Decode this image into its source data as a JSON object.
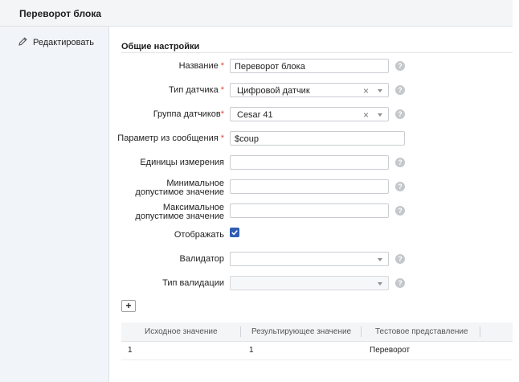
{
  "window": {
    "title": "Переворот блока"
  },
  "sidebar": {
    "edit_label": "Редактировать"
  },
  "section": {
    "title": "Общие настройки"
  },
  "form": {
    "name": {
      "label": "Название",
      "value": "Переворот блока"
    },
    "sensor_type": {
      "label": "Тип датчика",
      "value": "Цифровой датчик",
      "clear": "×"
    },
    "sensor_group": {
      "label": "Группа датчиков",
      "value": "Cesar 41",
      "clear": "×"
    },
    "message_param": {
      "label": "Параметр из сообщения",
      "value": "$coup"
    },
    "units": {
      "label": "Единицы измерения",
      "value": ""
    },
    "min_value": {
      "label_line1": "Минимальное",
      "label_line2": "допустимое значение",
      "value": ""
    },
    "max_value": {
      "label_line1": "Максимальное",
      "label_line2": "допустимое значение",
      "value": ""
    },
    "display": {
      "label": "Отображать",
      "checked": true
    },
    "validator": {
      "label": "Валидатор",
      "value": ""
    },
    "validation_type": {
      "label": "Тип валидации",
      "value": ""
    },
    "required_mark": "*",
    "help_glyph": "?"
  },
  "table": {
    "add_label": "+",
    "columns": [
      "Исходное значение",
      "Результирующее значение",
      "Тестовое представление"
    ],
    "rows": [
      [
        "1",
        "1",
        "Переворот"
      ]
    ]
  },
  "colors": {
    "accent": "#2f5db3",
    "required": "#e0463d",
    "sidebar_bg": "#f1f4f8"
  }
}
